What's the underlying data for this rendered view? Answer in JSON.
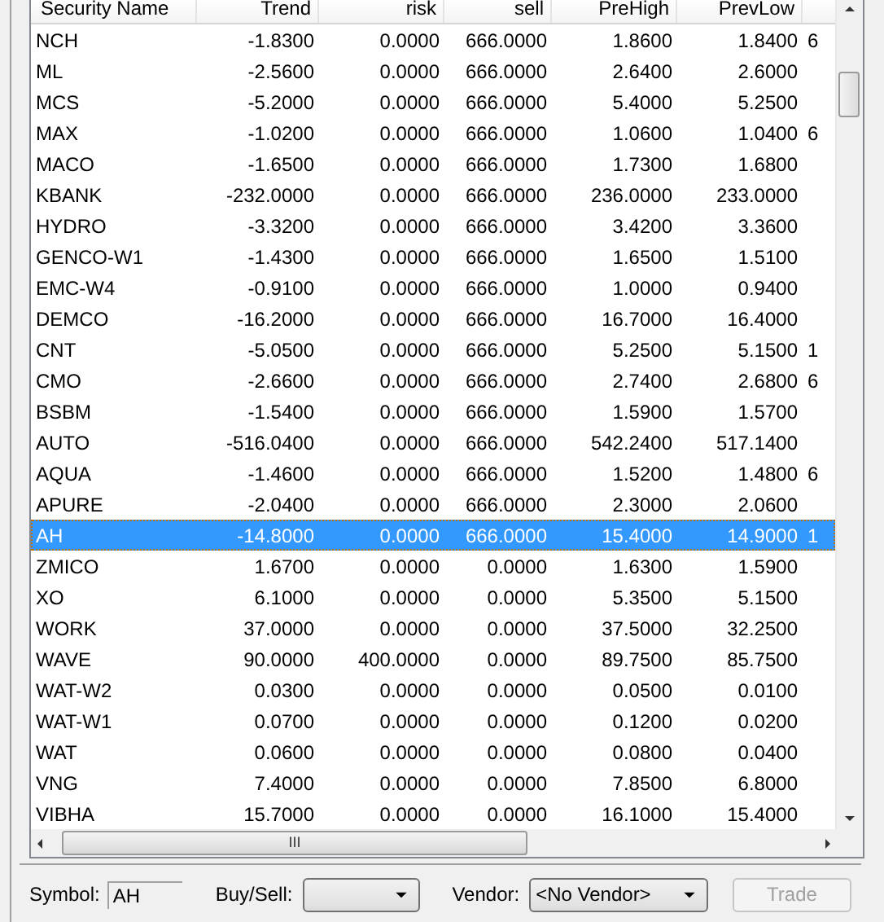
{
  "table": {
    "columns": [
      "Security Name",
      "Trend",
      "risk",
      "sell",
      "PreHigh",
      "PrevLow"
    ],
    "rows": [
      {
        "cells": [
          "NCH",
          "-1.8300",
          "0.0000",
          "666.0000",
          "1.8600",
          "1.8400"
        ],
        "column_7": "6",
        "selected": false
      },
      {
        "cells": [
          "ML",
          "-2.5600",
          "0.0000",
          "666.0000",
          "2.6400",
          "2.6000"
        ],
        "selected": false
      },
      {
        "cells": [
          "MCS",
          "-5.2000",
          "0.0000",
          "666.0000",
          "5.4000",
          "5.2500"
        ],
        "selected": false
      },
      {
        "cells": [
          "MAX",
          "-1.0200",
          "0.0000",
          "666.0000",
          "1.0600",
          "1.0400"
        ],
        "column_7": "6",
        "selected": false
      },
      {
        "cells": [
          "MACO",
          "-1.6500",
          "0.0000",
          "666.0000",
          "1.7300",
          "1.6800"
        ],
        "selected": false
      },
      {
        "cells": [
          "KBANK",
          "-232.0000",
          "0.0000",
          "666.0000",
          "236.0000",
          "233.0000"
        ],
        "selected": false
      },
      {
        "cells": [
          "HYDRO",
          "-3.3200",
          "0.0000",
          "666.0000",
          "3.4200",
          "3.3600"
        ],
        "selected": false
      },
      {
        "cells": [
          "GENCO-W1",
          "-1.4300",
          "0.0000",
          "666.0000",
          "1.6500",
          "1.5100"
        ],
        "selected": false
      },
      {
        "cells": [
          "EMC-W4",
          "-0.9100",
          "0.0000",
          "666.0000",
          "1.0000",
          "0.9400"
        ],
        "selected": false
      },
      {
        "cells": [
          "DEMCO",
          "-16.2000",
          "0.0000",
          "666.0000",
          "16.7000",
          "16.4000"
        ],
        "selected": false
      },
      {
        "cells": [
          "CNT",
          "-5.0500",
          "0.0000",
          "666.0000",
          "5.2500",
          "5.1500"
        ],
        "column_7": "1",
        "selected": false
      },
      {
        "cells": [
          "CMO",
          "-2.6600",
          "0.0000",
          "666.0000",
          "2.7400",
          "2.6800"
        ],
        "column_7": "6",
        "selected": false
      },
      {
        "cells": [
          "BSBM",
          "-1.5400",
          "0.0000",
          "666.0000",
          "1.5900",
          "1.5700"
        ],
        "selected": false
      },
      {
        "cells": [
          "AUTO",
          "-516.0400",
          "0.0000",
          "666.0000",
          "542.2400",
          "517.1400"
        ],
        "selected": false
      },
      {
        "cells": [
          "AQUA",
          "-1.4600",
          "0.0000",
          "666.0000",
          "1.5200",
          "1.4800"
        ],
        "column_7": "6",
        "selected": false
      },
      {
        "cells": [
          "APURE",
          "-2.0400",
          "0.0000",
          "666.0000",
          "2.3000",
          "2.0600"
        ],
        "selected": false
      },
      {
        "cells": [
          "AH",
          "-14.8000",
          "0.0000",
          "666.0000",
          "15.4000",
          "14.9000"
        ],
        "column_7": "1",
        "selected": true
      },
      {
        "cells": [
          "ZMICO",
          "1.6700",
          "0.0000",
          "0.0000",
          "1.6300",
          "1.5900"
        ],
        "selected": false
      },
      {
        "cells": [
          "XO",
          "6.1000",
          "0.0000",
          "0.0000",
          "5.3500",
          "5.1500"
        ],
        "selected": false
      },
      {
        "cells": [
          "WORK",
          "37.0000",
          "0.0000",
          "0.0000",
          "37.5000",
          "32.2500"
        ],
        "selected": false
      },
      {
        "cells": [
          "WAVE",
          "90.0000",
          "400.0000",
          "0.0000",
          "89.7500",
          "85.7500"
        ],
        "selected": false
      },
      {
        "cells": [
          "WAT-W2",
          "0.0300",
          "0.0000",
          "0.0000",
          "0.0500",
          "0.0100"
        ],
        "selected": false
      },
      {
        "cells": [
          "WAT-W1",
          "0.0700",
          "0.0000",
          "0.0000",
          "0.1200",
          "0.0200"
        ],
        "selected": false
      },
      {
        "cells": [
          "WAT",
          "0.0600",
          "0.0000",
          "0.0000",
          "0.0800",
          "0.0400"
        ],
        "selected": false
      },
      {
        "cells": [
          "VNG",
          "7.4000",
          "0.0000",
          "0.0000",
          "7.8500",
          "6.8000"
        ],
        "selected": false
      },
      {
        "cells": [
          "VIBHA",
          "15.7000",
          "0.0000",
          "0.0000",
          "16.1000",
          "15.4000"
        ],
        "selected": false
      }
    ]
  },
  "scrollbar_grip": "III",
  "form": {
    "symbol_label": "Symbol:",
    "symbol_value": "AH",
    "buysell_label": "Buy/Sell:",
    "vendor_label": "Vendor:",
    "vendor_value": "<No Vendor>",
    "trade_button": {
      "label": "Trade",
      "disabled": true
    }
  }
}
